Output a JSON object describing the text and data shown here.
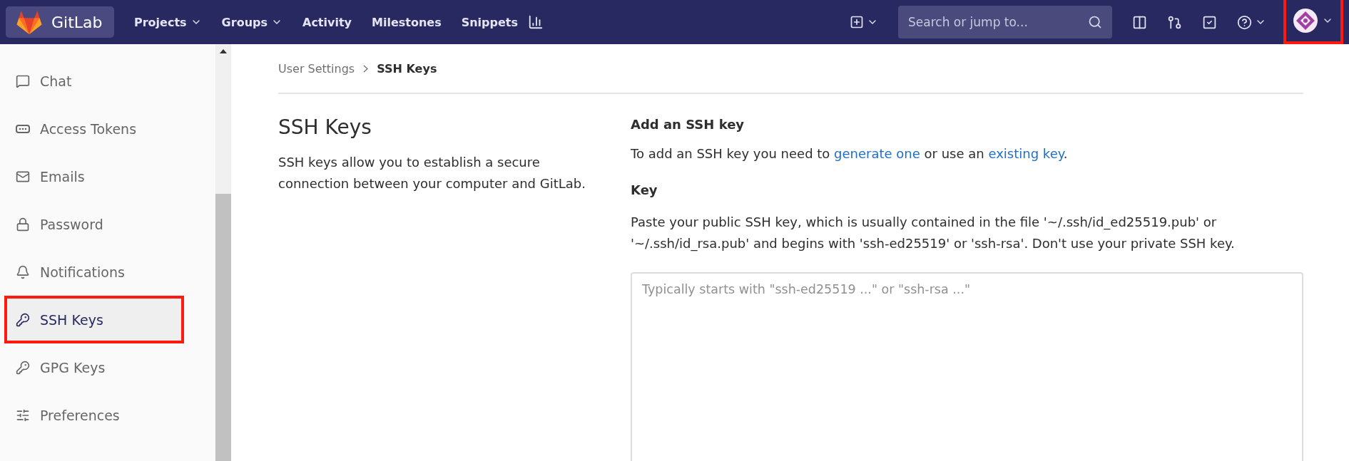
{
  "navbar": {
    "brand": "GitLab",
    "links": [
      {
        "label": "Projects",
        "dropdown": true
      },
      {
        "label": "Groups",
        "dropdown": true
      },
      {
        "label": "Activity",
        "dropdown": false
      },
      {
        "label": "Milestones",
        "dropdown": false
      },
      {
        "label": "Snippets",
        "dropdown": false
      }
    ],
    "search": {
      "placeholder": "Search or jump to..."
    },
    "avatar": {
      "annotated": true
    }
  },
  "sidebar": {
    "items": [
      {
        "label": "Chat",
        "selected": false,
        "annotated": false
      },
      {
        "label": "Access Tokens",
        "selected": false,
        "annotated": false
      },
      {
        "label": "Emails",
        "selected": false,
        "annotated": false
      },
      {
        "label": "Password",
        "selected": false,
        "annotated": false
      },
      {
        "label": "Notifications",
        "selected": false,
        "annotated": false
      },
      {
        "label": "SSH Keys",
        "selected": true,
        "annotated": true
      },
      {
        "label": "GPG Keys",
        "selected": false,
        "annotated": false
      },
      {
        "label": "Preferences",
        "selected": false,
        "annotated": false
      }
    ]
  },
  "breadcrumb": [
    "User Settings",
    "SSH Keys"
  ],
  "intro": {
    "title": "SSH Keys",
    "description": "SSH keys allow you to establish a secure connection between your computer and GitLab."
  },
  "form": {
    "heading": "Add an SSH key",
    "lead": {
      "before": "To add an SSH key you need to ",
      "link1": "generate one",
      "middle": " or use an ",
      "link2": "existing key",
      "after": "."
    },
    "key_label": "Key",
    "help": "Paste your public SSH key, which is usually contained in the file '~/.ssh/id_ed25519.pub' or '~/.ssh/id_rsa.pub' and begins with 'ssh-ed25519' or 'ssh-rsa'. Don't use your private SSH key.",
    "key_field": {
      "placeholder": "Typically starts with \"ssh-ed25519 ...\" or \"ssh-rsa ...\""
    }
  }
}
